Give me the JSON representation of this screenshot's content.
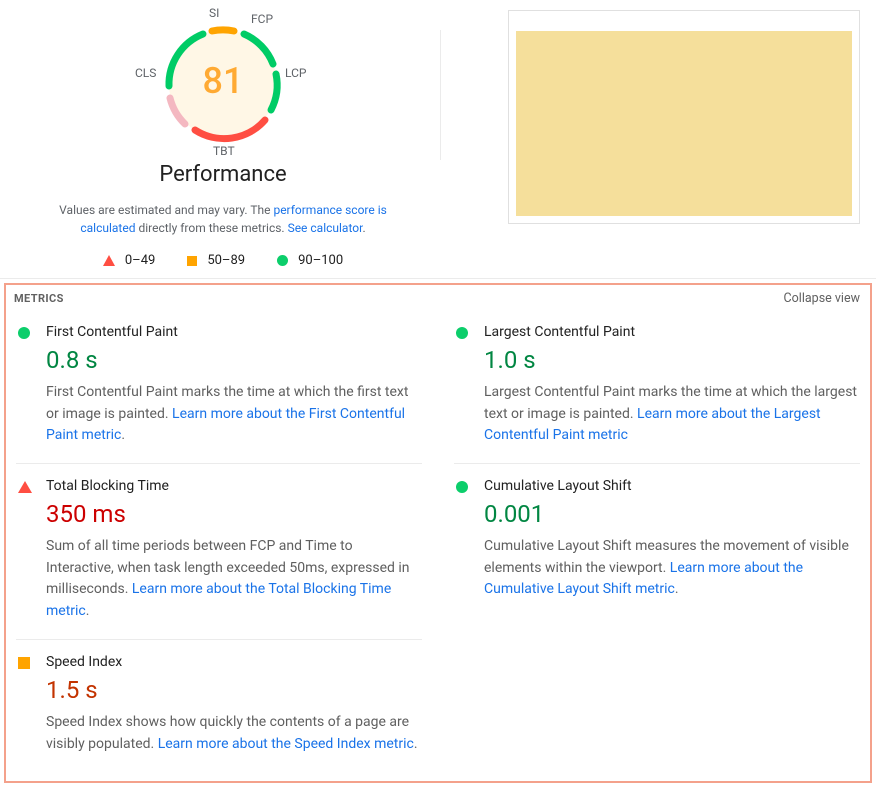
{
  "gauge": {
    "score": "81",
    "title": "Performance",
    "labels": {
      "si": "SI",
      "fcp": "FCP",
      "lcp": "LCP",
      "tbt": "TBT",
      "cls": "CLS"
    }
  },
  "disclaimer": {
    "pre": "Values are estimated and may vary. The ",
    "link1": "performance score is calculated",
    "mid": " directly from these metrics. ",
    "link2": "See calculator"
  },
  "legend": {
    "r0": "0–49",
    "r1": "50–89",
    "r2": "90–100"
  },
  "metrics_header": {
    "title": "METRICS",
    "collapse": "Collapse view"
  },
  "metrics": {
    "fcp": {
      "name": "First Contentful Paint",
      "value": "0.8 s",
      "desc": "First Contentful Paint marks the time at which the first text or image is painted. ",
      "link": "Learn more about the First Contentful Paint metric"
    },
    "lcp": {
      "name": "Largest Contentful Paint",
      "value": "1.0 s",
      "desc": "Largest Contentful Paint marks the time at which the largest text or image is painted. ",
      "link": "Learn more about the Largest Contentful Paint metric"
    },
    "tbt": {
      "name": "Total Blocking Time",
      "value": "350 ms",
      "desc": "Sum of all time periods between FCP and Time to Interactive, when task length exceeded 50ms, expressed in milliseconds. ",
      "link": "Learn more about the Total Blocking Time metric"
    },
    "cls": {
      "name": "Cumulative Layout Shift",
      "value": "0.001",
      "desc": "Cumulative Layout Shift measures the movement of visible elements within the viewport. ",
      "link": "Learn more about the Cumulative Layout Shift metric"
    },
    "si": {
      "name": "Speed Index",
      "value": "1.5 s",
      "desc": "Speed Index shows how quickly the contents of a page are visibly populated. ",
      "link": "Learn more about the Speed Index metric"
    }
  }
}
